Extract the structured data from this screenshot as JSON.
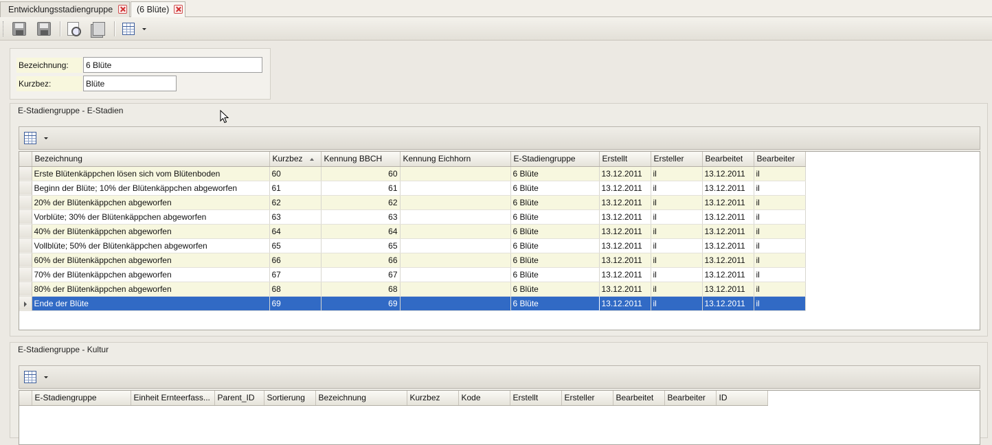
{
  "tabs": [
    {
      "label": "Entwicklungsstadiengruppe"
    },
    {
      "label": "(6 Blüte)"
    }
  ],
  "form": {
    "bezeichnung_label": "Bezeichnung:",
    "bezeichnung_value": "6 Blüte",
    "kurzbez_label": "Kurzbez:",
    "kurzbez_value": "Blüte"
  },
  "stadien": {
    "title": "E-Stadiengruppe - E-Stadien",
    "columns": [
      "Bezeichnung",
      "Kurzbez",
      "Kennung BBCH",
      "Kennung Eichhorn",
      "E-Stadiengruppe",
      "Erstellt",
      "Ersteller",
      "Bearbeitet",
      "Bearbeiter"
    ],
    "rows": [
      [
        "Erste Blütenkäppchen lösen sich vom Blütenboden",
        "60",
        "60",
        "",
        "6 Blüte",
        "13.12.2011",
        "il",
        "13.12.2011",
        "il"
      ],
      [
        "Beginn der Blüte; 10% der Blütenkäppchen abgeworfen",
        "61",
        "61",
        "",
        "6 Blüte",
        "13.12.2011",
        "il",
        "13.12.2011",
        "il"
      ],
      [
        "20% der Blütenkäppchen abgeworfen",
        "62",
        "62",
        "",
        "6 Blüte",
        "13.12.2011",
        "il",
        "13.12.2011",
        "il"
      ],
      [
        "Vorblüte; 30% der Blütenkäppchen abgeworfen",
        "63",
        "63",
        "",
        "6 Blüte",
        "13.12.2011",
        "il",
        "13.12.2011",
        "il"
      ],
      [
        "40% der Blütenkäppchen abgeworfen",
        "64",
        "64",
        "",
        "6 Blüte",
        "13.12.2011",
        "il",
        "13.12.2011",
        "il"
      ],
      [
        "Vollblüte; 50% der Blütenkäppchen abgeworfen",
        "65",
        "65",
        "",
        "6 Blüte",
        "13.12.2011",
        "il",
        "13.12.2011",
        "il"
      ],
      [
        "60% der Blütenkäppchen abgeworfen",
        "66",
        "66",
        "",
        "6 Blüte",
        "13.12.2011",
        "il",
        "13.12.2011",
        "il"
      ],
      [
        "70% der Blütenkäppchen abgeworfen",
        "67",
        "67",
        "",
        "6 Blüte",
        "13.12.2011",
        "il",
        "13.12.2011",
        "il"
      ],
      [
        "80% der Blütenkäppchen abgeworfen",
        "68",
        "68",
        "",
        "6 Blüte",
        "13.12.2011",
        "il",
        "13.12.2011",
        "il"
      ],
      [
        "Ende der Blüte",
        "69",
        "69",
        "",
        "6 Blüte",
        "13.12.2011",
        "il",
        "13.12.2011",
        "il"
      ]
    ],
    "selected_row": 9
  },
  "kultur": {
    "title": "E-Stadiengruppe - Kultur",
    "columns": [
      "E-Stadiengruppe",
      "Einheit Ernteerfass...",
      "Parent_ID",
      "Sortierung",
      "Bezeichnung",
      "Kurzbez",
      "Kode",
      "Erstellt",
      "Ersteller",
      "Bearbeitet",
      "Bearbeiter",
      "ID"
    ]
  },
  "colors": {
    "selection": "#316ac5",
    "alt_row": "#f7f7df",
    "label_bg": "#f8f7dd"
  },
  "icons": [
    "save-close-icon",
    "save-icon",
    "print-preview-icon",
    "print-icon",
    "grid-layout-icon"
  ]
}
